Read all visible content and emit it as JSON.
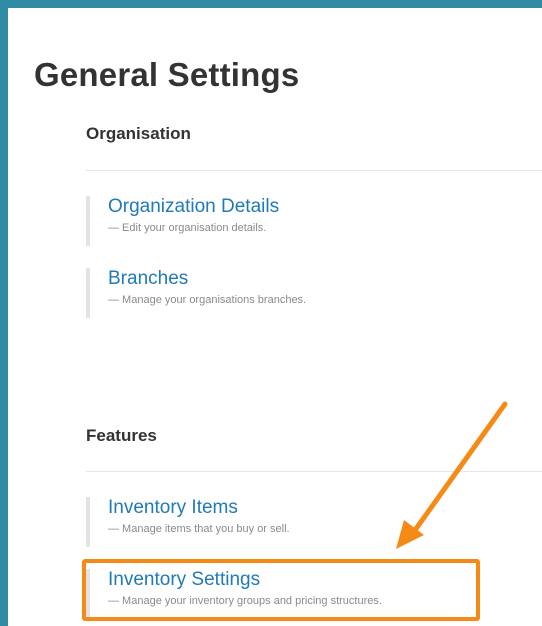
{
  "page": {
    "title": "General Settings"
  },
  "sections": [
    {
      "title": "Organisation",
      "items": [
        {
          "label": "Organization Details",
          "description": "— Edit your organisation details."
        },
        {
          "label": "Branches",
          "description": "— Manage your organisations branches."
        }
      ]
    },
    {
      "title": "Features",
      "items": [
        {
          "label": "Inventory Items",
          "description": "— Manage items that you buy or sell."
        },
        {
          "label": "Inventory Settings",
          "description": "— Manage your inventory groups and pricing structures."
        }
      ]
    }
  ],
  "annotation": {
    "color": "#f58a17",
    "target": "Inventory Settings"
  },
  "colors": {
    "frame": "#2f8aa3",
    "link": "#1f7ab8"
  }
}
